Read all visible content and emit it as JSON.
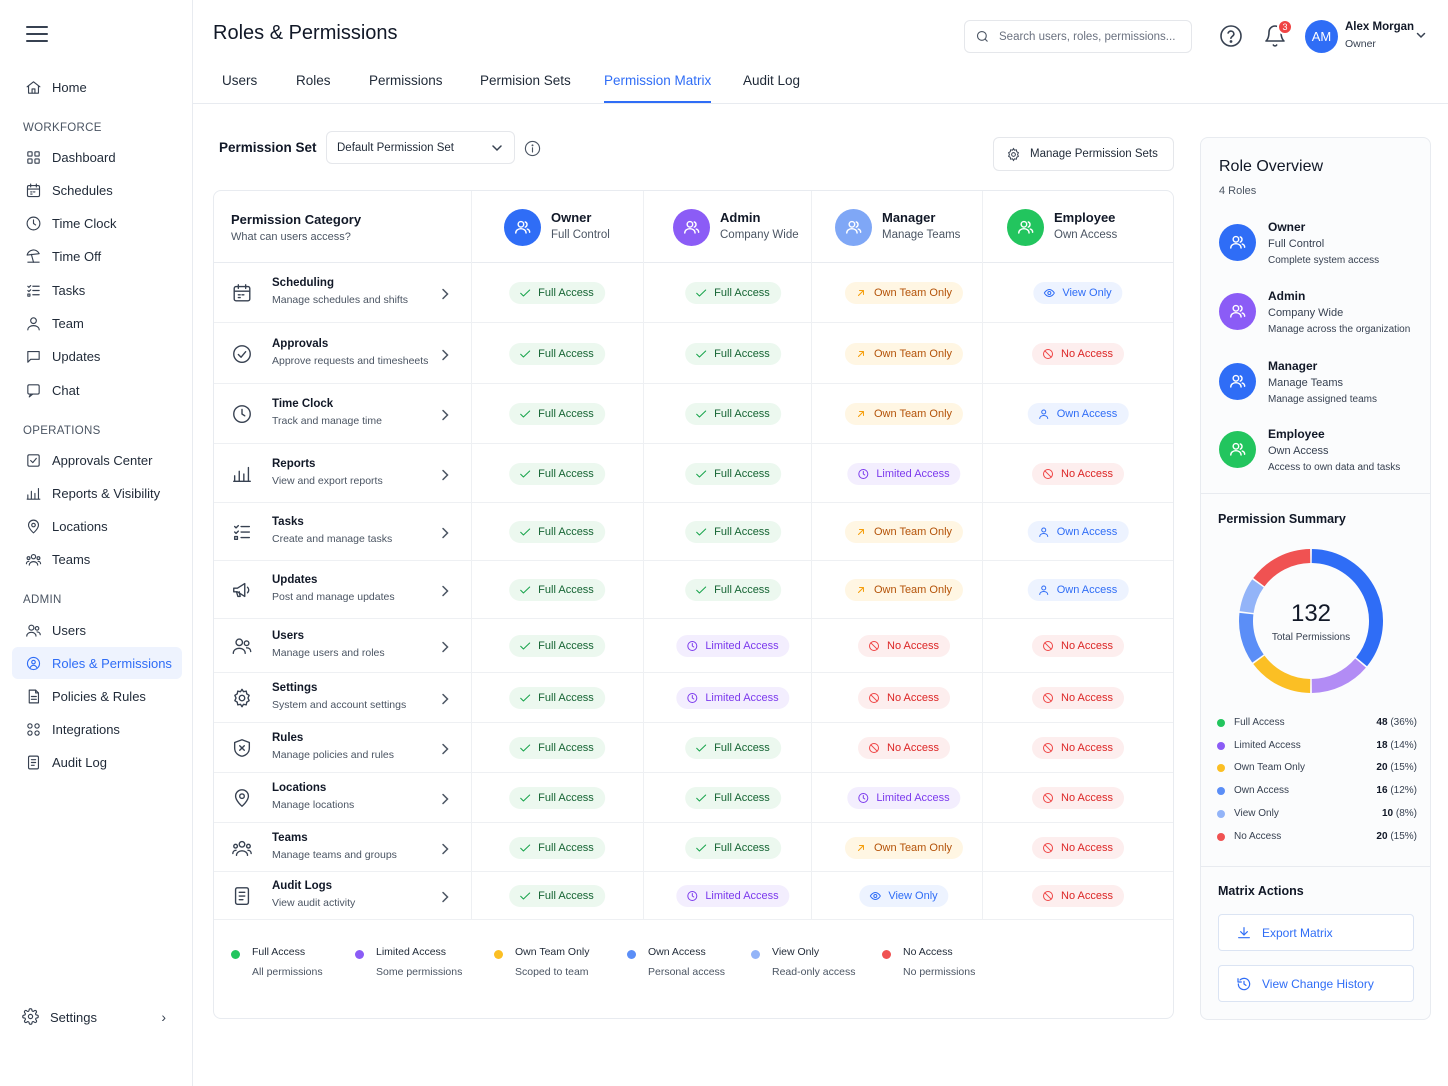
{
  "app": {
    "page_title": "Roles & Permissions",
    "search_placeholder": "Search users, roles, permissions...",
    "notification_count": "3",
    "user": {
      "initials": "AM",
      "name": "Alex Morgan",
      "role": "Owner"
    }
  },
  "sidebar": {
    "home": "Home",
    "section_workforce": "WORKFORCE",
    "workforce": [
      {
        "label": "Dashboard",
        "icon": "grid-icon"
      },
      {
        "label": "Schedules",
        "icon": "calendar-icon"
      },
      {
        "label": "Time Clock",
        "icon": "clock-icon"
      },
      {
        "label": "Time Off",
        "icon": "beach-icon"
      },
      {
        "label": "Tasks",
        "icon": "tasks-icon"
      },
      {
        "label": "Team",
        "icon": "user-icon"
      },
      {
        "label": "Updates",
        "icon": "message-icon"
      },
      {
        "label": "Chat",
        "icon": "chat-icon"
      }
    ],
    "section_operations": "OPERATIONS",
    "operations": [
      {
        "label": "Approvals Center",
        "icon": "checkbox-icon"
      },
      {
        "label": "Reports & Visibility",
        "icon": "bar-chart-icon"
      },
      {
        "label": "Locations",
        "icon": "pin-icon"
      },
      {
        "label": "Teams",
        "icon": "teams-icon"
      }
    ],
    "section_admin": "ADMIN",
    "admin": [
      {
        "label": "Users",
        "icon": "users-icon"
      },
      {
        "label": "Roles & Permissions",
        "icon": "roles-icon",
        "active": true
      },
      {
        "label": "Policies & Rules",
        "icon": "document-icon"
      },
      {
        "label": "Integrations",
        "icon": "integrations-icon"
      },
      {
        "label": "Audit Log",
        "icon": "log-icon"
      }
    ],
    "settings": "Settings"
  },
  "tabs": [
    "Users",
    "Roles",
    "Permissions",
    "Permision Sets",
    "Permission Matrix",
    "Audit Log"
  ],
  "active_tab": "Permission Matrix",
  "permission_set": {
    "label": "Permission Set",
    "selected": "Default Permission Set",
    "manage_button": "Manage Permission Sets"
  },
  "matrix": {
    "category_header": "Permission Category",
    "category_subheader": "What can users access?",
    "roles": [
      {
        "name": "Owner",
        "sub": "Full Control",
        "color": "#2f6df6"
      },
      {
        "name": "Admin",
        "sub": "Company Wide",
        "color": "#8b5cf6"
      },
      {
        "name": "Manager",
        "sub": "Manage Teams",
        "color": "#7fa7f6"
      },
      {
        "name": "Employee",
        "sub": "Own Access",
        "color": "#22c55e"
      }
    ],
    "rows": [
      {
        "title": "Scheduling",
        "sub": "Manage schedules and shifts",
        "icon": "calendar-icon",
        "cells": [
          "Full Access",
          "Full Access",
          "Own Team Only",
          "View Only"
        ]
      },
      {
        "title": "Approvals",
        "sub": "Approve requests and timesheets",
        "icon": "check-circle-icon",
        "cells": [
          "Full Access",
          "Full Access",
          "Own Team Only",
          "No Access"
        ]
      },
      {
        "title": "Time Clock",
        "sub": "Track and manage time",
        "icon": "clock-icon",
        "cells": [
          "Full Access",
          "Full Access",
          "Own Team Only",
          "Own Access"
        ]
      },
      {
        "title": "Reports",
        "sub": "View and export reports",
        "icon": "bar-chart-icon",
        "cells": [
          "Full Access",
          "Full Access",
          "Limited Access",
          "No Access"
        ]
      },
      {
        "title": "Tasks",
        "sub": "Create and manage tasks",
        "icon": "tasks-icon",
        "cells": [
          "Full Access",
          "Full Access",
          "Own Team Only",
          "Own Access"
        ]
      },
      {
        "title": "Updates",
        "sub": "Post and manage updates",
        "icon": "megaphone-icon",
        "cells": [
          "Full Access",
          "Full Access",
          "Own Team Only",
          "Own Access"
        ]
      },
      {
        "title": "Users",
        "sub": "Manage users and roles",
        "icon": "users-icon",
        "cells": [
          "Full Access",
          "Limited Access",
          "No Access",
          "No Access"
        ]
      },
      {
        "title": "Settings",
        "sub": "System and account settings",
        "icon": "gear-icon",
        "cells": [
          "Full Access",
          "Limited Access",
          "No Access",
          "No Access"
        ]
      },
      {
        "title": "Rules",
        "sub": "Manage policies and rules",
        "icon": "shield-icon",
        "cells": [
          "Full Access",
          "Full Access",
          "No Access",
          "No Access"
        ]
      },
      {
        "title": "Locations",
        "sub": "Manage locations",
        "icon": "pin-icon",
        "cells": [
          "Full Access",
          "Full Access",
          "Limited Access",
          "No Access"
        ]
      },
      {
        "title": "Teams",
        "sub": "Manage teams and groups",
        "icon": "teams-icon",
        "cells": [
          "Full Access",
          "Full Access",
          "Own Team Only",
          "No Access"
        ]
      },
      {
        "title": "Audit Logs",
        "sub": "View audit activity",
        "icon": "log-icon",
        "cells": [
          "Full Access",
          "Limited Access",
          "View Only",
          "No Access"
        ]
      }
    ],
    "legend": [
      {
        "title": "Full Access",
        "sub": "All permissions",
        "color": "#22c55e"
      },
      {
        "title": "Limited Access",
        "sub": "Some permissions",
        "color": "#8b5cf6"
      },
      {
        "title": "Own Team Only",
        "sub": "Scoped to team",
        "color": "#fbbf24"
      },
      {
        "title": "Own Access",
        "sub": "Personal access",
        "color": "#5b8ef7"
      },
      {
        "title": "View Only",
        "sub": "Read-only access",
        "color": "#93b4f8"
      },
      {
        "title": "No Access",
        "sub": "No permissions",
        "color": "#f05252"
      }
    ]
  },
  "overview": {
    "title": "Role Overview",
    "count": "4 Roles",
    "roles": [
      {
        "name": "Owner",
        "sub": "Full Control",
        "desc": "Complete system access",
        "color": "#2f6df6"
      },
      {
        "name": "Admin",
        "sub": "Company Wide",
        "desc": "Manage across the organization",
        "color": "#8b5cf6"
      },
      {
        "name": "Manager",
        "sub": "Manage Teams",
        "desc": "Manage assigned teams",
        "color": "#2f6df6"
      },
      {
        "name": "Employee",
        "sub": "Own Access",
        "desc": "Access to own data and tasks",
        "color": "#22c55e"
      }
    ]
  },
  "summary": {
    "title": "Permission Summary",
    "total": "132",
    "total_label": "Total Permissions",
    "items": [
      {
        "label": "Full Access",
        "count": 48,
        "pct": "(36%)",
        "color": "#22c55e"
      },
      {
        "label": "Limited Access",
        "count": 18,
        "pct": "(14%)",
        "color": "#8b5cf6"
      },
      {
        "label": "Own Team Only",
        "count": 20,
        "pct": "(15%)",
        "color": "#fbbf24"
      },
      {
        "label": "Own Access",
        "count": 16,
        "pct": "(12%)",
        "color": "#5b8ef7"
      },
      {
        "label": "View Only",
        "count": 10,
        "pct": "(8%)",
        "color": "#93b4f8"
      },
      {
        "label": "No Access",
        "count": 20,
        "pct": "(15%)",
        "color": "#f05252"
      }
    ],
    "donut_segments": [
      {
        "name": "Own Access",
        "value": 36,
        "color": "#2f6df6"
      },
      {
        "name": "Limited Access",
        "value": 14,
        "color": "#b28cf5"
      },
      {
        "name": "Own Team Only",
        "value": 15,
        "color": "#fbbf24"
      },
      {
        "name": "Own Access",
        "value": 12,
        "color": "#5b8ef7"
      },
      {
        "name": "View Only",
        "value": 8,
        "color": "#93b4f8"
      },
      {
        "name": "No Access",
        "value": 15,
        "color": "#f05252"
      }
    ]
  },
  "actions": {
    "title": "Matrix Actions",
    "export": "Export Matrix",
    "history": "View Change History"
  }
}
